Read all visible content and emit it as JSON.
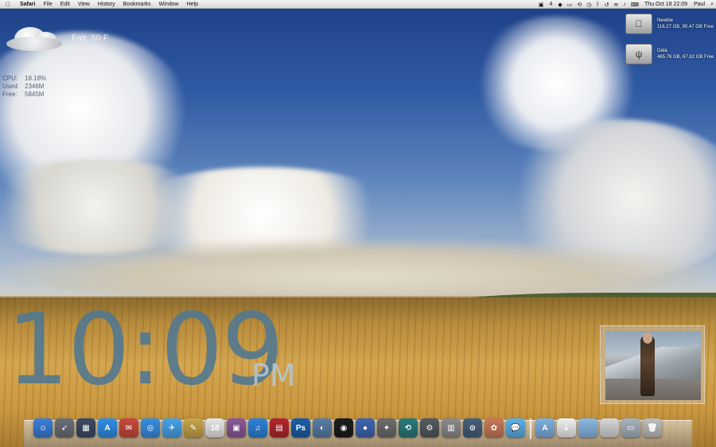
{
  "menubar": {
    "app_name": "Safari",
    "menus": [
      "File",
      "Edit",
      "View",
      "History",
      "Bookmarks",
      "Window",
      "Help"
    ],
    "status": {
      "badge_count": "4",
      "datetime": "Thu Oct 18  22:09",
      "user": "Paul"
    }
  },
  "weather": {
    "condition": "Fair, 50 F"
  },
  "stats": {
    "rows": [
      {
        "label": "CPU:",
        "value": "18.18%"
      },
      {
        "label": "Used:",
        "value": "2346M"
      },
      {
        "label": "Free:",
        "value": "5845M"
      }
    ]
  },
  "disks": [
    {
      "name": "Newbie",
      "line": "116.27 GB, 90.47 GB Free"
    },
    {
      "name": "Data",
      "line": "465.76 GB, 67.82 GB Free"
    }
  ],
  "clock": {
    "time": "10:09",
    "ampm": "PM"
  },
  "dock": {
    "apps": [
      {
        "name": "finder-icon",
        "color": "#3b7fd8",
        "glyph": "☺"
      },
      {
        "name": "launchpad-icon",
        "color": "#6c6f78",
        "glyph": "➶"
      },
      {
        "name": "mission-control-icon",
        "color": "#3d4b63",
        "glyph": "▦"
      },
      {
        "name": "app-store-icon",
        "color": "#2f8fe6",
        "glyph": "A"
      },
      {
        "name": "mail-stamp-icon",
        "color": "#c94a3e",
        "glyph": "✉"
      },
      {
        "name": "safari-icon",
        "color": "#3a8ee0",
        "glyph": "◎"
      },
      {
        "name": "mail-icon",
        "color": "#4aa3e8",
        "glyph": "✈"
      },
      {
        "name": "notes-icon",
        "color": "#c9a54a",
        "glyph": "✎"
      },
      {
        "name": "calendar-icon",
        "color": "#e8e8e8",
        "glyph": "18"
      },
      {
        "name": "photo-booth-icon",
        "color": "#8b5a9a",
        "glyph": "▣"
      },
      {
        "name": "itunes-icon",
        "color": "#2e82d8",
        "glyph": "♫"
      },
      {
        "name": "photo-browser-icon",
        "color": "#b3262e",
        "glyph": "▤"
      },
      {
        "name": "photoshop-icon",
        "color": "#1c5fa8",
        "glyph": "Ps"
      },
      {
        "name": "iphoto-icon",
        "color": "#5a7ea6",
        "glyph": "◐"
      },
      {
        "name": "dashboard-icon",
        "color": "#1d1d1d",
        "glyph": "◉"
      },
      {
        "name": "network-globe-icon",
        "color": "#4166b0",
        "glyph": "●"
      },
      {
        "name": "utility-icon",
        "color": "#6d6d6d",
        "glyph": "✦"
      },
      {
        "name": "time-machine-icon",
        "color": "#2a7a7a",
        "glyph": "⟲"
      },
      {
        "name": "settings-icon",
        "color": "#555a60",
        "glyph": "⚙"
      },
      {
        "name": "preview-icon",
        "color": "#8c8c8c",
        "glyph": "▥"
      },
      {
        "name": "camera-icon",
        "color": "#47607a",
        "glyph": "⊙"
      },
      {
        "name": "cleaner-icon",
        "color": "#c87a5a",
        "glyph": "✿"
      },
      {
        "name": "messages-icon",
        "color": "#5fb0e8",
        "glyph": "💬"
      }
    ],
    "folders": [
      {
        "name": "applications-folder-icon",
        "color": "#7fb1e0",
        "glyph": "A"
      },
      {
        "name": "document-icon",
        "color": "#f1f1f1",
        "glyph": "⇣"
      },
      {
        "name": "folder-icon",
        "color": "#8cb9e4",
        "glyph": ""
      },
      {
        "name": "drive-icon",
        "color": "#d8d8d8",
        "glyph": ""
      },
      {
        "name": "window-icon",
        "color": "#a8b4c0",
        "glyph": "▭"
      },
      {
        "name": "trash-icon",
        "color": "#bfbfbf",
        "glyph": "🗑"
      }
    ]
  }
}
